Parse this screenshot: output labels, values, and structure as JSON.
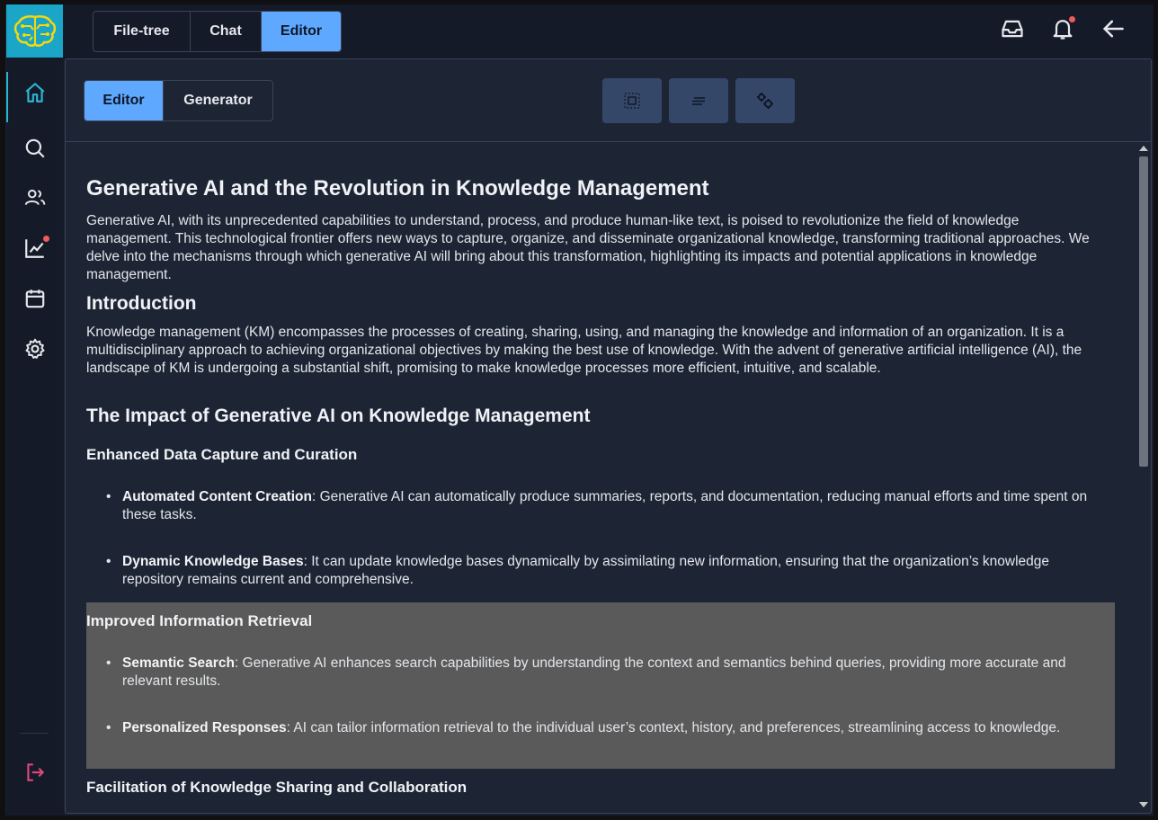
{
  "top_tabs": [
    "File-tree",
    "Chat",
    "Editor"
  ],
  "top_tabs_active": 2,
  "panel_tabs": [
    "Editor",
    "Generator"
  ],
  "panel_tabs_active": 0,
  "toolbar_icons": [
    "select-frame-icon",
    "align-text-icon",
    "gears-icon"
  ],
  "sidebar": {
    "items": [
      "home-icon",
      "search-icon",
      "users-icon",
      "chart-icon",
      "calendar-icon",
      "settings-icon"
    ],
    "active": 0
  },
  "doc": {
    "title": "Generative AI and the Revolution in Knowledge Management",
    "intro": "Generative AI, with its unprecedented capabilities to understand, process, and produce human-like text, is poised to revolutionize the field of knowledge management. This technological frontier offers new ways to capture, organize, and disseminate organizational knowledge, transforming traditional approaches. We delve into the mechanisms through which generative AI will bring about this transformation, highlighting its impacts and potential applications in knowledge management.",
    "introduction_heading": "Introduction",
    "introduction_text": "Knowledge management (KM) encompasses the processes of creating, sharing, using, and managing the knowledge and information of an organization. It is a multidisciplinary approach to achieving organizational objectives by making the best use of knowledge. With the advent of generative artificial intelligence (AI), the landscape of KM is undergoing a substantial shift, promising to make knowledge processes more efficient, intuitive, and scalable.",
    "impact_heading": "The Impact of Generative AI on Knowledge Management",
    "sections": [
      {
        "heading": "Enhanced Data Capture and Curation",
        "items": [
          {
            "term": "Automated Content Creation",
            "text": ": Generative AI can automatically produce summaries, reports, and documentation, reducing manual efforts and time spent on these tasks."
          },
          {
            "term": "Dynamic Knowledge Bases",
            "text": ": It can update knowledge bases dynamically by assimilating new information, ensuring that the organization’s knowledge repository remains current and comprehensive."
          }
        ]
      },
      {
        "heading": "Improved Information Retrieval",
        "items": [
          {
            "term": "Semantic Search",
            "text": ": Generative AI enhances search capabilities by understanding the context and semantics behind queries, providing more accurate and relevant results."
          },
          {
            "term": "Personalized Responses",
            "text": ": AI can tailor information retrieval to the individual user’s context, history, and preferences, streamlining access to knowledge."
          }
        ]
      },
      {
        "heading": "Facilitation of Knowledge Sharing and Collaboration",
        "items": []
      }
    ]
  },
  "colors": {
    "accent": "#5ea8ff",
    "logo_bg": "#1ba6c8",
    "notification_dot": "#ef5b5b",
    "logout": "#e0457b",
    "highlight": "#5a5a5a"
  }
}
